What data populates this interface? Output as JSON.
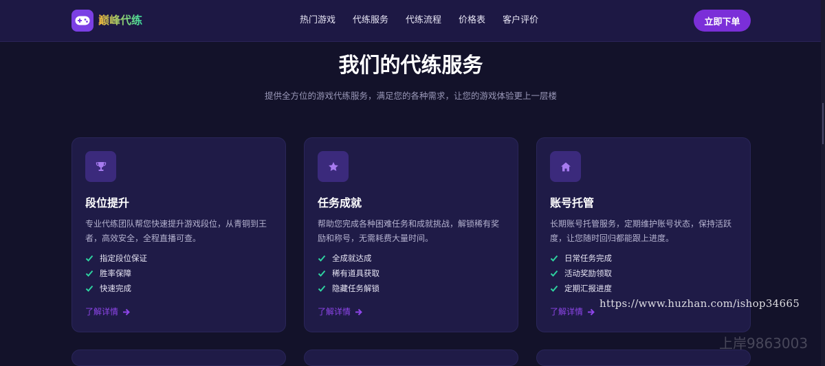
{
  "brand": {
    "name": "巅峰代练",
    "logo_icon": "gamepad-icon",
    "accent": "#7b3fe4"
  },
  "nav": {
    "links": [
      "热门游戏",
      "代练服务",
      "代练流程",
      "价格表",
      "客户评价"
    ],
    "order_button": "立即下单"
  },
  "section": {
    "title": "我们的代练服务",
    "subtitle": "提供全方位的游戏代练服务，满足您的各种需求，让您的游戏体验更上一层楼"
  },
  "cards": [
    {
      "icon": "trophy-icon",
      "title": "段位提升",
      "desc": "专业代练团队帮您快速提升游戏段位，从青铜到王者，高效安全，全程直播可查。",
      "features": [
        "指定段位保证",
        "胜率保障",
        "快速完成"
      ],
      "link": "了解详情"
    },
    {
      "icon": "star-icon",
      "title": "任务成就",
      "desc": "帮助您完成各种困难任务和成就挑战，解锁稀有奖励和称号，无需耗费大量时间。",
      "features": [
        "全成就达成",
        "稀有道具获取",
        "隐藏任务解锁"
      ],
      "link": "了解详情"
    },
    {
      "icon": "home-icon",
      "title": "账号托管",
      "desc": "长期账号托管服务，定期维护账号状态，保持活跃度，让您随时回归都能跟上进度。",
      "features": [
        "日常任务完成",
        "活动奖励领取",
        "定期汇报进度"
      ],
      "link": "了解详情"
    }
  ],
  "colors": {
    "background": "#13122a",
    "card": "#1f1b47",
    "check": "#2ed3a0",
    "link": "#8d45e8"
  },
  "watermarks": {
    "url": "https://www.huzhan.com/ishop34665",
    "id": "上岸9863003"
  }
}
